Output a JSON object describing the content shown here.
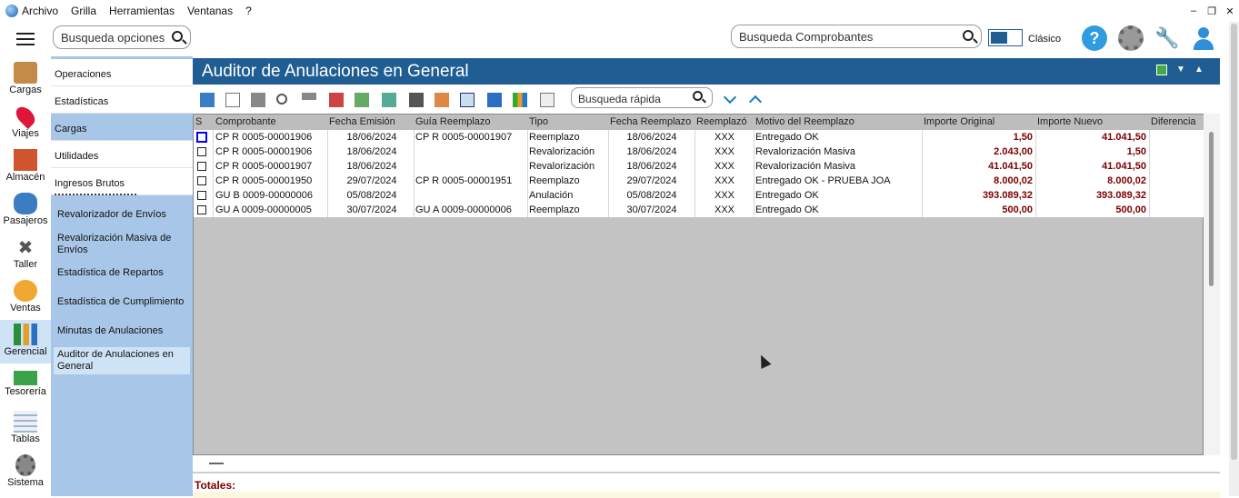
{
  "menubar": {
    "items": [
      "Archivo",
      "Grilla",
      "Herramientas",
      "Ventanas",
      "?"
    ]
  },
  "topbar": {
    "search_options_placeholder": "Busqueda opciones",
    "search_comprobantes_placeholder": "Busqueda Comprobantes",
    "mode_label": "Clásico"
  },
  "left_nav": [
    {
      "label": "Cargas",
      "icon": "box-icon"
    },
    {
      "label": "Viajes",
      "icon": "location-pin-icon"
    },
    {
      "label": "Almacén",
      "icon": "warehouse-icon"
    },
    {
      "label": "Pasajeros",
      "icon": "passenger-icon"
    },
    {
      "label": "Taller",
      "icon": "tools-icon"
    },
    {
      "label": "Ventas",
      "icon": "sales-icon"
    },
    {
      "label": "Gerencial",
      "icon": "bar-chart-icon"
    },
    {
      "label": "Tesorería",
      "icon": "money-icon"
    },
    {
      "label": "Tablas",
      "icon": "table-icon"
    },
    {
      "label": "Sistema",
      "icon": "gear-icon"
    }
  ],
  "menu_groups": [
    "Operaciones",
    "Estadísticas",
    "Cargas",
    "Utilidades",
    "Ingresos Brutos"
  ],
  "submenu": [
    "Revalorizador de Envíos",
    "Revalorización Masiva de Envíos",
    "Estadística de Repartos",
    "Estadística de Cumplimiento",
    "Minutas de Anulaciones",
    "Auditor de Anulaciones en General"
  ],
  "main": {
    "title": "Auditor de Anulaciones en General",
    "quick_search_placeholder": "Busqueda rápida"
  },
  "grid": {
    "columns": [
      "S",
      "Comprobante",
      "Fecha Emisión",
      "Guía Reemplazo",
      "Tipo",
      "Fecha Reemplazo",
      "Reemplazó",
      "Motivo del Reemplazo",
      "Importe Original",
      "Importe Nuevo",
      "Diferencia"
    ],
    "rows": [
      {
        "comprobante": "CP R 0005-00001906",
        "fecha": "18/06/2024",
        "guia": "CP R 0005-00001907",
        "tipo": "Reemplazo",
        "fecha_reemp": "18/06/2024",
        "reemplazo": "XXX",
        "motivo": "Entregado OK",
        "importe_orig": "1,50",
        "importe_nuevo": "41.041,50"
      },
      {
        "comprobante": "CP R 0005-00001906",
        "fecha": "18/06/2024",
        "guia": "",
        "tipo": "Revalorización",
        "fecha_reemp": "18/06/2024",
        "reemplazo": "XXX",
        "motivo": "Revalorización Masiva",
        "importe_orig": "2.043,00",
        "importe_nuevo": "1,50"
      },
      {
        "comprobante": "CP R 0005-00001907",
        "fecha": "18/06/2024",
        "guia": "",
        "tipo": "Revalorización",
        "fecha_reemp": "18/06/2024",
        "reemplazo": "XXX",
        "motivo": "Revalorización Masiva",
        "importe_orig": "41.041,50",
        "importe_nuevo": "41.041,50"
      },
      {
        "comprobante": "CP R 0005-00001950",
        "fecha": "29/07/2024",
        "guia": "CP R 0005-00001951",
        "tipo": "Reemplazo",
        "fecha_reemp": "29/07/2024",
        "reemplazo": "XXX",
        "motivo": "Entregado OK - PRUEBA JOA",
        "importe_orig": "8.000,02",
        "importe_nuevo": "8.000,02"
      },
      {
        "comprobante": "GU B 0009-00000006",
        "fecha": "05/08/2024",
        "guia": "",
        "tipo": "Anulación",
        "fecha_reemp": "05/08/2024",
        "reemplazo": "XXX",
        "motivo": "Entregado OK",
        "importe_orig": "393.089,32",
        "importe_nuevo": "393.089,32"
      },
      {
        "comprobante": "GU A 0009-00000005",
        "fecha": "30/07/2024",
        "guia": "GU A 0009-00000006",
        "tipo": "Reemplazo",
        "fecha_reemp": "30/07/2024",
        "reemplazo": "XXX",
        "motivo": "Entregado OK",
        "importe_orig": "500,00",
        "importe_nuevo": "500,00"
      }
    ]
  },
  "totals_label": "Totales:"
}
